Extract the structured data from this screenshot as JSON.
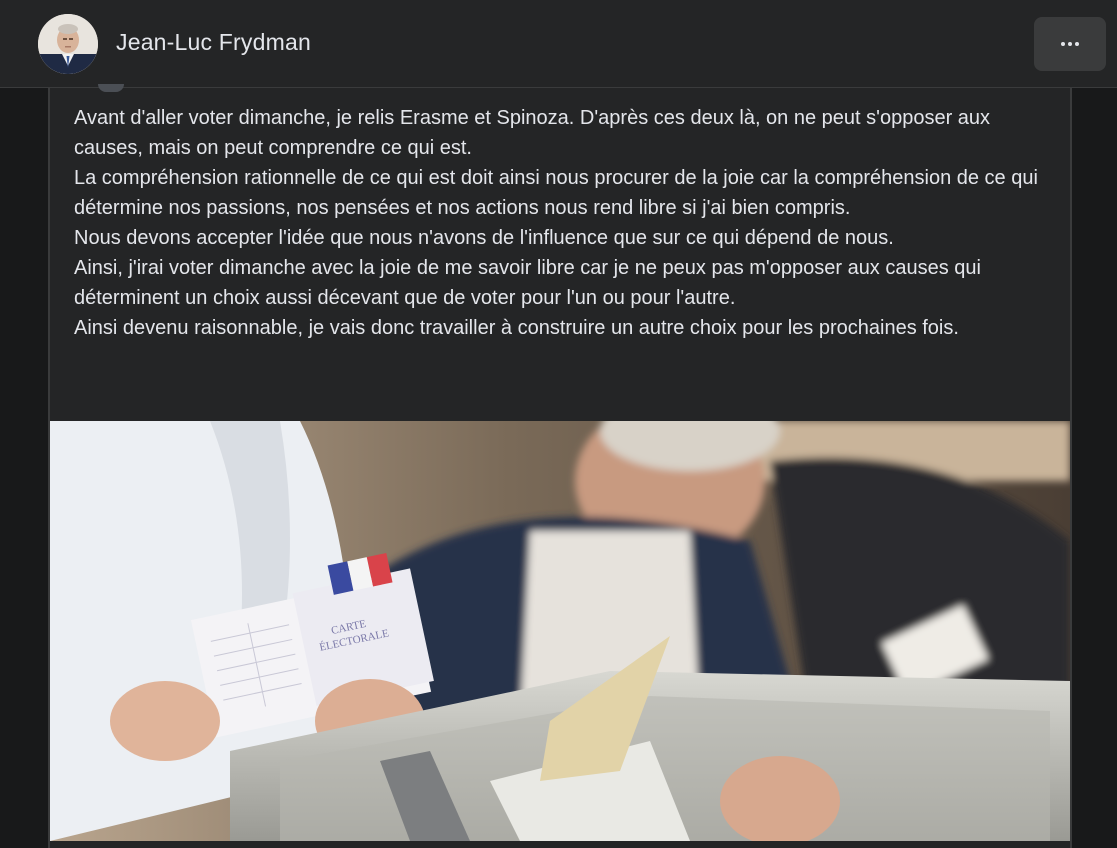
{
  "header": {
    "author_name": "Jean-Luc Frydman",
    "avatar_icon": "profile-photo",
    "more_icon": "more-options-icon"
  },
  "post": {
    "paragraphs": [
      "Avant d'aller voter dimanche, je relis Erasme et Spinoza. D'après ces deux là, on ne peut s'opposer aux causes, mais on peut comprendre ce qui est.",
      "La compréhension rationnelle de ce qui est doit ainsi nous procurer de la joie car la compréhension de ce qui détermine nos passions, nos pensées et nos actions nous rend libre si j'ai bien compris.",
      "Nous devons accepter l'idée que nous n'avons de l'influence que sur ce qui dépend de nous.",
      "Ainsi, j'irai voter dimanche avec la joie de me savoir libre car je ne peux pas m'opposer aux causes qui déterminent un choix aussi décevant que de voter pour l'un ou pour l'autre.",
      "Ainsi devenu raisonnable, je vais donc travailler à construire un autre choix pour les prochaines fois."
    ],
    "photo": {
      "description_icon": "voting-ballot-box-photo",
      "card_text_line1": "CARTE",
      "card_text_line2": "ÉLECTORALE"
    }
  },
  "colors": {
    "background": "#18191a",
    "surface": "#242526",
    "text": "#e4e6eb",
    "button": "#3a3b3c"
  }
}
